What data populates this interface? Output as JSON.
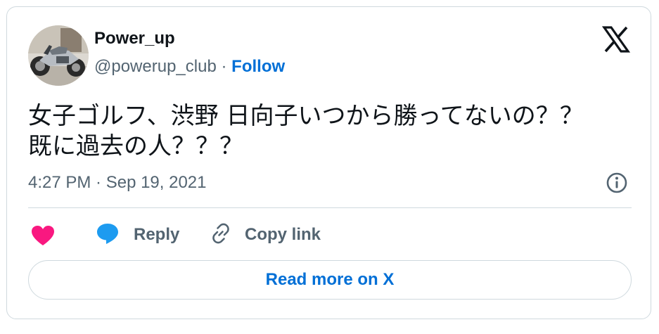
{
  "author": {
    "display_name": "Power_up",
    "handle": "@powerup_club",
    "separator": "·",
    "follow_label": "Follow",
    "avatar_icon": "motorcycle-avatar"
  },
  "brand": {
    "logo_icon": "x-logo-icon"
  },
  "tweet": {
    "text_line1": "女子ゴルフ、渋野 日向子いつから勝ってないの？？",
    "text_line2": "既に過去の人？？？",
    "timestamp": "4:27 PM · Sep 19, 2021"
  },
  "actions": {
    "like_icon": "heart-icon",
    "reply_label": "Reply",
    "copy_label": "Copy link",
    "info_icon": "info-icon"
  },
  "footer": {
    "read_more_label": "Read more on X"
  },
  "colors": {
    "accent_blue": "#006fd6",
    "heart_pink": "#f91880",
    "reply_blue": "#1d9bf0",
    "text_primary": "#0f1419",
    "text_secondary": "#536471",
    "border": "#cfd9de"
  }
}
